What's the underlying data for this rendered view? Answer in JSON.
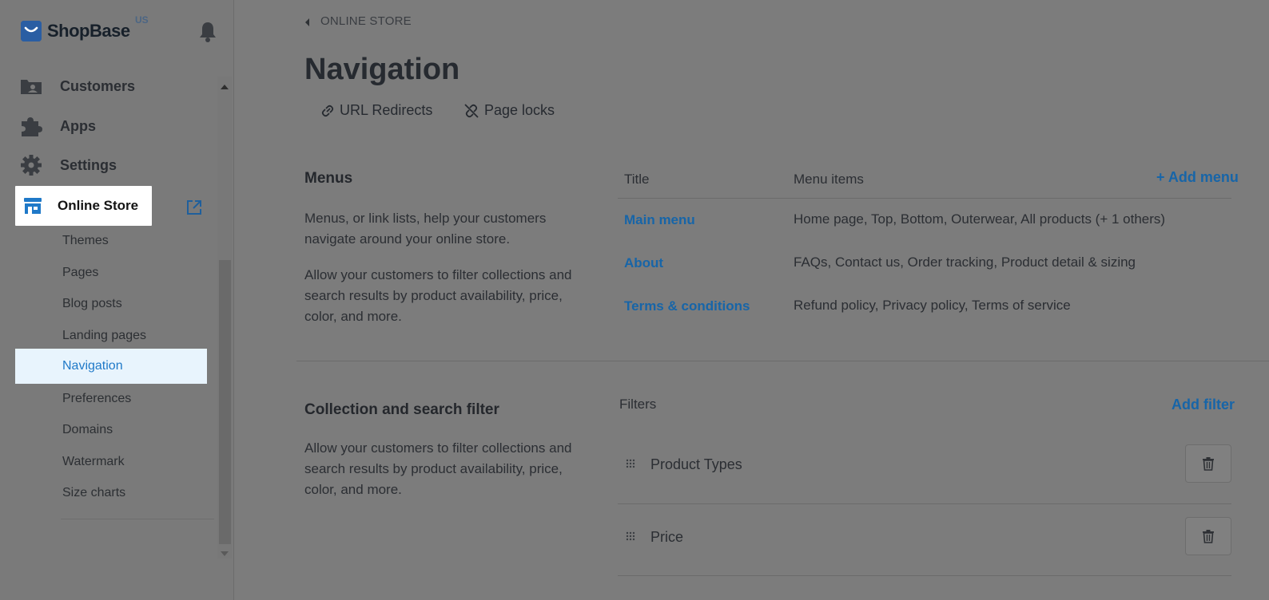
{
  "brand": {
    "name": "ShopBase",
    "region": "US"
  },
  "sidebar": {
    "main_items": [
      {
        "label": "Customers",
        "icon": "customers-icon"
      },
      {
        "label": "Apps",
        "icon": "puzzle-icon"
      },
      {
        "label": "Settings",
        "icon": "gear-icon"
      }
    ],
    "online_store": {
      "label": "Online Store",
      "icon": "storefront-icon"
    },
    "sub_items": [
      "Themes",
      "Pages",
      "Blog posts",
      "Landing pages",
      "Navigation",
      "Preferences",
      "Domains",
      "Watermark",
      "Size charts"
    ],
    "active": "Navigation"
  },
  "header": {
    "breadcrumb": "ONLINE STORE",
    "title": "Navigation",
    "actions": [
      {
        "label": "URL Redirects",
        "icon": "link-icon"
      },
      {
        "label": "Page locks",
        "icon": "unlink-icon"
      }
    ]
  },
  "menus": {
    "title": "Menus",
    "description_1": "Menus, or link lists, help your customers navigate around your online store.",
    "description_2": "Allow your customers to filter collections and search results by product availability, price, color, and more.",
    "col_title": "Title",
    "col_items": "Menu items",
    "add_label": "+ Add menu",
    "rows": [
      {
        "title": "Main menu",
        "items": "Home page, Top, Bottom, Outerwear, All products (+ 1 others)"
      },
      {
        "title": "About",
        "items": "FAQs, Contact us, Order tracking, Product detail & sizing"
      },
      {
        "title": "Terms & conditions",
        "items": "Refund policy, Privacy policy, Terms of service"
      }
    ]
  },
  "filters": {
    "title": "Collection and search filter",
    "description": "Allow your customers to filter collections and search results by product availability, price, color, and more.",
    "col_label": "Filters",
    "add_label": "Add filter",
    "rows": [
      {
        "name": "Product Types"
      },
      {
        "name": "Price"
      }
    ]
  },
  "colors": {
    "link": "#1765a8",
    "active_bg": "#e8f4fd",
    "active_text": "#1f79c8",
    "overlay": "#7c7c7c"
  }
}
